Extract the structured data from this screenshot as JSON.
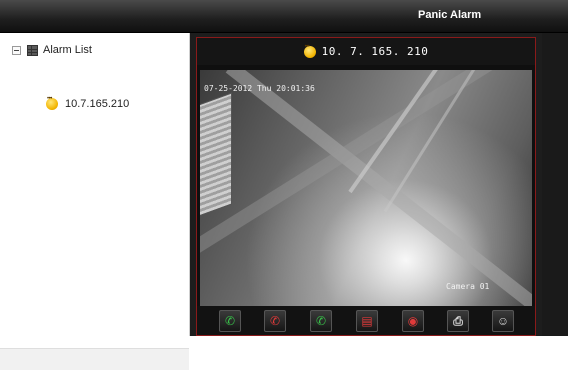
{
  "window": {
    "title": "Panic Alarm"
  },
  "tree": {
    "root_label": "Alarm List",
    "items": [
      {
        "label": "10.7.165.210"
      }
    ]
  },
  "video": {
    "header_ip": "10. 7. 165. 210",
    "osd_datetime": "07-25-2012 Thu 20:01:36",
    "osd_camera": "Camera 01"
  },
  "toolbar": {
    "buttons": [
      {
        "name": "accept-call-button",
        "icon": "phone-answer-icon",
        "glyph": "✆",
        "color": "#39c24a"
      },
      {
        "name": "hang-up-button",
        "icon": "phone-hangup-icon",
        "glyph": "✆",
        "color": "#e03a3a"
      },
      {
        "name": "call-timer-button",
        "icon": "phone-clock-icon",
        "glyph": "✆",
        "color": "#39c24a"
      },
      {
        "name": "alarm-output-button",
        "icon": "alarm-box-icon",
        "glyph": "▤",
        "color": "#e03a3a"
      },
      {
        "name": "stop-alarm-button",
        "icon": "alarm-off-icon",
        "glyph": "◉",
        "color": "#e03a3a"
      },
      {
        "name": "print-button",
        "icon": "printer-icon",
        "glyph": "⎙",
        "color": "#d8d8d8"
      },
      {
        "name": "user-button",
        "icon": "user-icon",
        "glyph": "☺",
        "color": "#d8d8d8"
      }
    ]
  },
  "colors": {
    "frame_border": "#8a1a1a",
    "status_online": "#f2b400"
  }
}
